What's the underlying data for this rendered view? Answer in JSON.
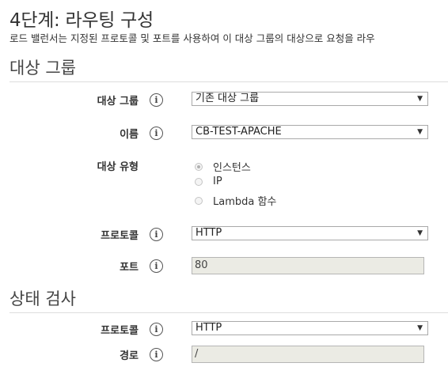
{
  "page": {
    "title": "4단계: 라우팅 구성",
    "subtitle": "로드 밸런서는 지정된 프로토콜 및 포트를 사용하여 이 대상 그룹의 대상으로 요청을 라우"
  },
  "target_group_section": {
    "title": "대상 그룹",
    "target_group": {
      "label": "대상 그룹",
      "value": "기존 대상 그룹"
    },
    "name": {
      "label": "이름",
      "value": "CB-TEST-APACHE"
    },
    "target_type": {
      "label": "대상 유형",
      "options": [
        "인스턴스",
        "IP",
        "Lambda 함수"
      ],
      "selected": "인스턴스"
    },
    "protocol": {
      "label": "프로토콜",
      "value": "HTTP"
    },
    "port": {
      "label": "포트",
      "value": "80"
    }
  },
  "health_check_section": {
    "title": "상태 검사",
    "protocol": {
      "label": "프로토콜",
      "value": "HTTP"
    },
    "path": {
      "label": "경로",
      "value": "/"
    }
  },
  "icons": {
    "info": "info-icon",
    "caret": "caret-down-icon"
  }
}
